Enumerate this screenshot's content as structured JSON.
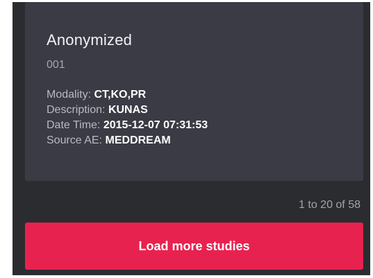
{
  "study": {
    "patient_name": "Anonymized",
    "patient_id": "001",
    "fields": [
      {
        "label": "Modality:",
        "value": "CT,KO,PR"
      },
      {
        "label": "Description:",
        "value": "KUNAS"
      },
      {
        "label": "Date Time:",
        "value": "2015-12-07 07:31:53"
      },
      {
        "label": "Source AE:",
        "value": "MEDDREAM"
      }
    ]
  },
  "pagination": {
    "summary": "1 to 20 of 58"
  },
  "actions": {
    "load_more_label": "Load more studies"
  },
  "colors": {
    "panel_bg": "#2b2c30",
    "card_bg": "#3a3b44",
    "accent": "#e8224f"
  }
}
